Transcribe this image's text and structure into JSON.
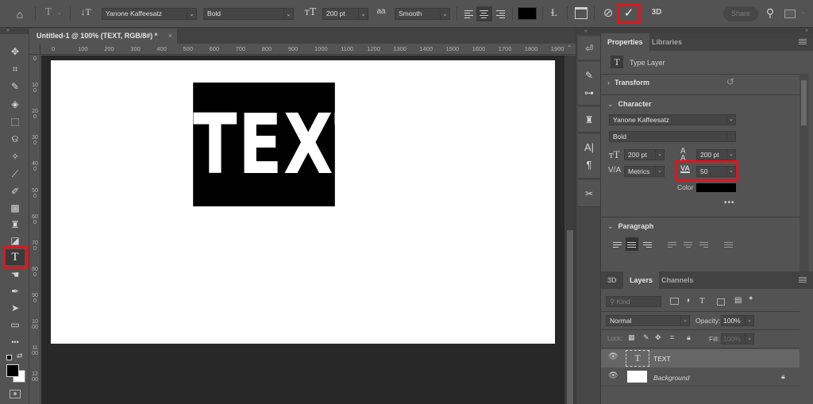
{
  "options_bar": {
    "home_icon": "home-icon",
    "tool_preset_icon": "type-tool-icon",
    "orientation_icon": "text-orientation-icon",
    "font_family": "Yanone Kaffeesatz",
    "font_style": "Bold",
    "font_size_icon": "font-size-icon",
    "font_size": "200 pt",
    "antialias_icon": "aa",
    "antialias": "Smooth",
    "align_options": [
      "left",
      "center",
      "right"
    ],
    "active_align": "center",
    "text_color": "#000000",
    "warp_icon": "warp-text-icon",
    "panels_icon": "character-panel-icon",
    "cancel_icon": "cancel-icon",
    "commit_icon": "commit-check-icon",
    "three_d_label": "3D",
    "share_label": "Share",
    "search_icon": "search-icon",
    "workspace_icon": "workspace-icon"
  },
  "document": {
    "tab_title": "Untitled-1 @ 100% (TEXT, RGB/8#) *",
    "close_label": "×",
    "canvas_text": "TEXT",
    "h_ruler": [
      "0",
      "100",
      "200",
      "300",
      "400",
      "500",
      "600",
      "700",
      "800",
      "900",
      "1000",
      "1100",
      "1200",
      "1300",
      "1400",
      "1500",
      "1600",
      "1700",
      "1800",
      "1900"
    ],
    "v_ruler": [
      "0",
      "100",
      "200",
      "300",
      "400",
      "500",
      "600",
      "700",
      "800",
      "900",
      "1000",
      "1100",
      "1200"
    ]
  },
  "toolbar": {
    "collapse": "»",
    "tools": [
      {
        "name": "move-tool",
        "glyph": "✥"
      },
      {
        "name": "crop-tool",
        "glyph": "⌗"
      },
      {
        "name": "eyedropper-tool",
        "glyph": "✎"
      },
      {
        "name": "paint-bucket-tool",
        "glyph": "◈"
      },
      {
        "name": "marquee-tool",
        "glyph": "⬚"
      },
      {
        "name": "lasso-tool",
        "glyph": "ଡ"
      },
      {
        "name": "magic-wand-tool",
        "glyph": "✧"
      },
      {
        "name": "healing-tool",
        "glyph": "⟋"
      },
      {
        "name": "brush-tool",
        "glyph": "✐"
      },
      {
        "name": "eraser-pattern-tool",
        "glyph": "▩"
      },
      {
        "name": "clone-stamp-tool",
        "glyph": "♜"
      },
      {
        "name": "eraser-tool",
        "glyph": "◪"
      },
      {
        "name": "type-tool",
        "glyph": "T"
      },
      {
        "name": "smudge-tool",
        "glyph": "☚"
      },
      {
        "name": "pen-tool",
        "glyph": "✒"
      },
      {
        "name": "path-selection-tool",
        "glyph": "➤"
      },
      {
        "name": "rectangle-tool",
        "glyph": "▭"
      },
      {
        "name": "more-tools",
        "glyph": "•••"
      }
    ],
    "foreground_color": "#000000",
    "background_color": "#ffffff"
  },
  "dock": {
    "icons": [
      "history-icon",
      "brush-settings-icon",
      "adjustments-icon",
      "clone-source-icon",
      "character-icon",
      "paragraph-icon",
      "tool-presets-icon"
    ],
    "glyphs": [
      "⏎",
      "✎",
      "⊶",
      "♜",
      "A|",
      "¶",
      "✂"
    ]
  },
  "properties": {
    "tabs": [
      "Properties",
      "Libraries"
    ],
    "active_tab": "Properties",
    "layer_type": "Type Layer",
    "transform_label": "Transform",
    "character_label": "Character",
    "font_family": "Yanone Kaffeesatz",
    "font_style": "Bold",
    "font_size": "200 pt",
    "leading": "200 pt",
    "kerning": "Metrics",
    "tracking": "50",
    "color_label": "Color",
    "color": "#000000",
    "more": "•••",
    "paragraph_label": "Paragraph"
  },
  "layers_panel": {
    "tabs": [
      "3D",
      "Layers",
      "Channels"
    ],
    "active_tab": "Layers",
    "filter_placeholder": "Kind",
    "blend_mode": "Normal",
    "opacity_label": "Opacity:",
    "opacity": "100%",
    "lock_label": "Lock:",
    "fill_label": "Fill:",
    "fill": "100%",
    "layers": [
      {
        "name": "TEXT",
        "type": "text",
        "visible": true,
        "selected": true
      },
      {
        "name": "Background",
        "type": "raster",
        "visible": true,
        "locked": true
      }
    ]
  },
  "highlight_color": "#e0151d"
}
